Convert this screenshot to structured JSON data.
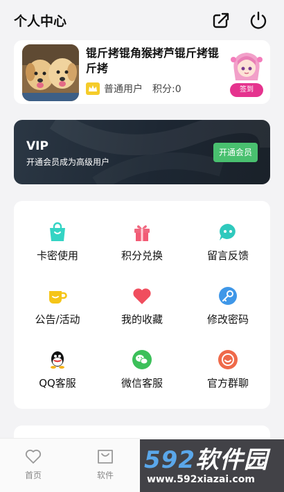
{
  "header": {
    "title": "个人中心"
  },
  "profile": {
    "username": "锟斤拷锟角猴拷芦锟斤拷锟斤拷",
    "level": "普通用户",
    "points": "积分:0",
    "signin_label": "签到"
  },
  "vip": {
    "title": "VIP",
    "subtitle": "开通会员成为高级用户",
    "button": "开通会员"
  },
  "menu": [
    {
      "label": "卡密使用",
      "icon": "bag-icon"
    },
    {
      "label": "积分兑换",
      "icon": "gift-icon"
    },
    {
      "label": "留言反馈",
      "icon": "chat-icon"
    },
    {
      "label": "公告/活动",
      "icon": "cup-icon"
    },
    {
      "label": "我的收藏",
      "icon": "heart-icon"
    },
    {
      "label": "修改密码",
      "icon": "key-icon"
    },
    {
      "label": "QQ客服",
      "icon": "qq-icon"
    },
    {
      "label": "微信客服",
      "icon": "wechat-icon"
    },
    {
      "label": "官方群聊",
      "icon": "group-icon"
    }
  ],
  "tabs": [
    {
      "label": "首页",
      "icon": "heart-outline-icon"
    },
    {
      "label": "软件",
      "icon": "bag-outline-icon"
    }
  ],
  "watermark": {
    "brand_number": "592",
    "brand_text": "软件园",
    "url": "www.592xiazai.com"
  },
  "colors": {
    "vip_button": "#49c06f",
    "signin_button": "#e5338e",
    "crown": "#f5cc2a"
  }
}
